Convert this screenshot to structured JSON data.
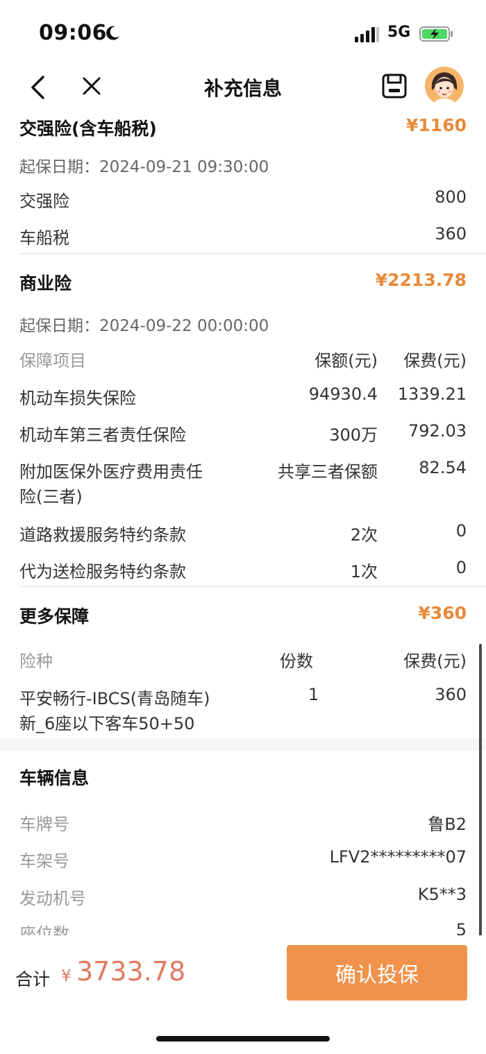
{
  "status": {
    "time": "09:06",
    "network": "5G"
  },
  "nav": {
    "title": "补充信息"
  },
  "compulsory": {
    "title": "交强险(含车船税)",
    "amount": "¥1160",
    "start_date": "起保日期：2024-09-21 09:30:00",
    "items": [
      {
        "label": "交强险",
        "value": "800"
      },
      {
        "label": "车船税",
        "value": "360"
      }
    ]
  },
  "commercial": {
    "title": "商业险",
    "amount": "¥2213.78",
    "start_date": "起保日期：2024-09-22 00:00:00",
    "headers": {
      "item": "保障项目",
      "amount": "保额(元)",
      "fee": "保费(元)"
    },
    "rows": [
      {
        "name": "机动车损失保险",
        "amount": "94930.4",
        "fee": "1339.21"
      },
      {
        "name": "机动车第三者责任保险",
        "amount": "300万",
        "fee": "792.03"
      },
      {
        "name": "附加医保外医疗费用责任",
        "name2": "险(三者)",
        "amount": "共享三者保额",
        "fee": "82.54"
      },
      {
        "name": "道路救援服务特约条款",
        "amount": "2次",
        "fee": "0"
      },
      {
        "name": "代为送检服务特约条款",
        "amount": "1次",
        "fee": "0"
      }
    ]
  },
  "more": {
    "title": "更多保障",
    "amount": "¥360",
    "headers": {
      "type": "险种",
      "count": "份数",
      "fee": "保费(元)"
    },
    "rows": [
      {
        "name": "平安畅行-IBCS(青岛随车)",
        "name2": "新_6座以下客车50+50",
        "count": "1",
        "fee": "360"
      }
    ]
  },
  "vehicle": {
    "title": "车辆信息",
    "items": [
      {
        "label": "车牌号",
        "value": "鲁B2"
      },
      {
        "label": "车架号",
        "value": "LFV2*********07"
      },
      {
        "label": "发动机号",
        "value": "K5**3"
      },
      {
        "label": "座位数",
        "value": "5"
      }
    ]
  },
  "footer": {
    "total_label": "合计",
    "currency": "¥",
    "total": "3733.78",
    "confirm": "确认投保"
  },
  "colors": {
    "accent": "#e88a3a",
    "button": "#f0924b",
    "total": "#e07a5f"
  }
}
